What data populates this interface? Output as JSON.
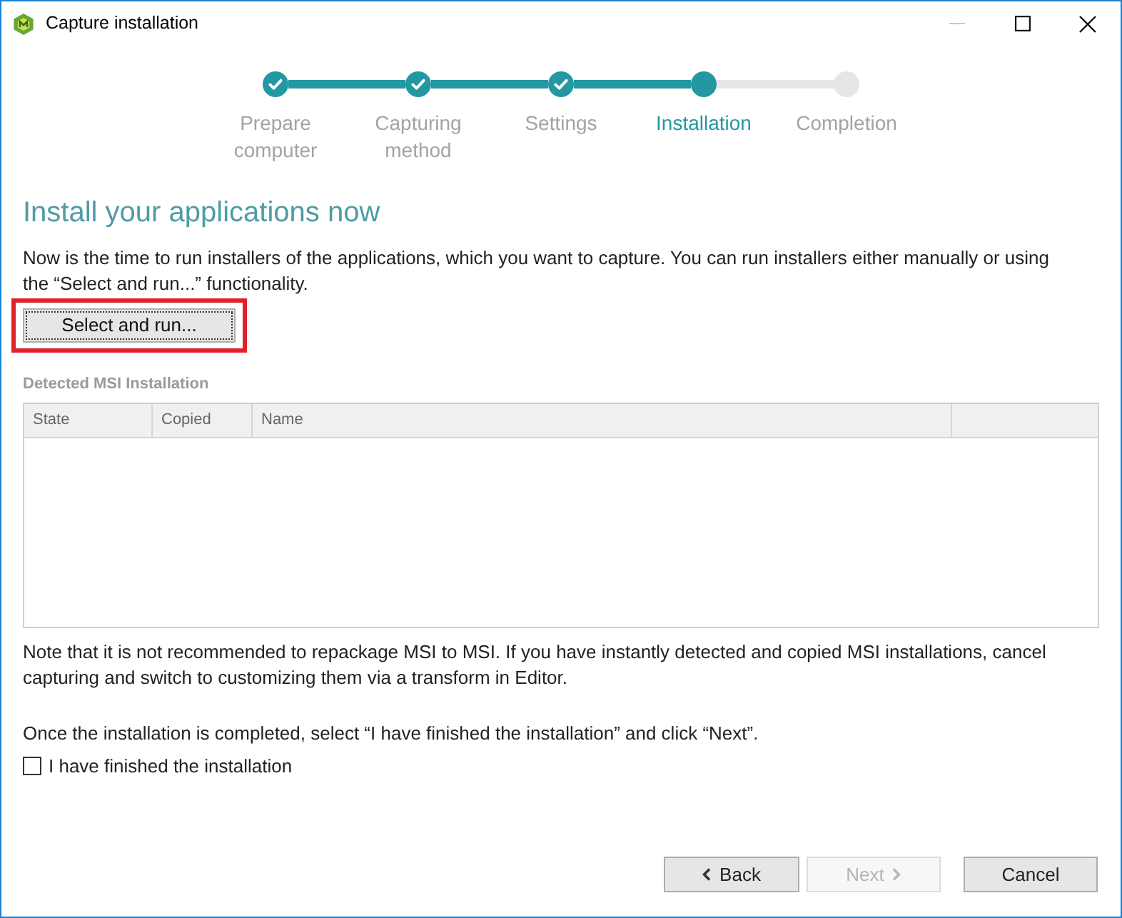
{
  "window": {
    "title": "Capture installation",
    "controls": [
      {
        "kind": "minimize",
        "disabled": true
      },
      {
        "kind": "maximize",
        "disabled": false
      },
      {
        "kind": "close",
        "disabled": false
      }
    ]
  },
  "steps": [
    {
      "label": "Prepare computer",
      "completed": true,
      "active": false
    },
    {
      "label": "Capturing method",
      "completed": true,
      "active": false
    },
    {
      "label": "Settings",
      "completed": true,
      "active": false
    },
    {
      "label": "Installation",
      "completed": false,
      "active": true
    },
    {
      "label": "Completion",
      "completed": false,
      "active": false
    }
  ],
  "heading": "Install your applications now",
  "intro": "Now is the time to run installers of the applications, which you want to capture. You can run installers either manually or using the “Select and run...” functionality.",
  "select_button": {
    "label": "Select and run...",
    "highlighted": true
  },
  "table": {
    "title": "Detected MSI Installation",
    "columns": [
      "State",
      "Copied",
      "Name"
    ]
  },
  "note": "Note that it is not recommended to repackage MSI to MSI. If you have instantly detected and copied MSI installations, cancel capturing and switch to customizing them via a transform in Editor.",
  "instruction": "Once the installation is completed, select “I have finished the installation” and click “Next”.",
  "finished_checkbox": {
    "label": "I have finished the installation",
    "checked": false
  },
  "buttons": [
    {
      "label": "Back",
      "kind": "back",
      "disabled": false
    },
    {
      "label": "Next",
      "kind": "next",
      "disabled": true
    },
    {
      "label": "Cancel",
      "kind": "cancel",
      "disabled": false
    }
  ]
}
